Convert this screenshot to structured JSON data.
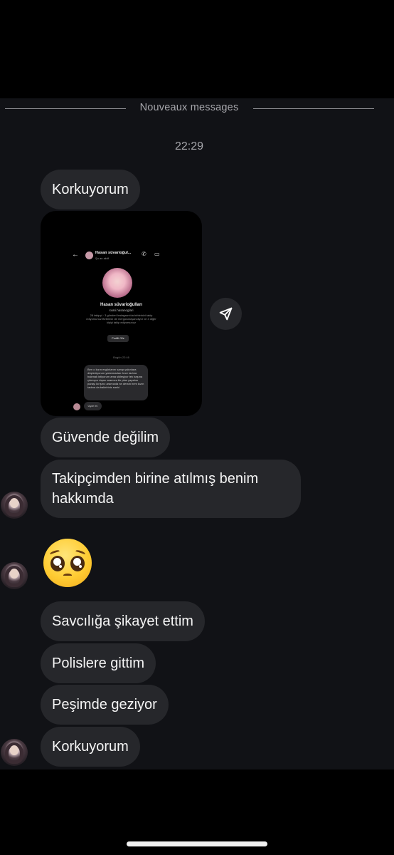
{
  "divider": {
    "label": "Nouveaux messages"
  },
  "timestamp": "22:29",
  "messages": [
    {
      "text": "Korkuyorum"
    },
    {
      "text": "Güvende değilim"
    },
    {
      "text": "Takipçimden birine atılmış benim hakkımda"
    },
    {
      "text": "🥺"
    },
    {
      "text": "Savcılığa şikayet ettim"
    },
    {
      "text": "Polislere gittim"
    },
    {
      "text": "Peşimde geziyor"
    },
    {
      "text": "Korkuyorum"
    }
  ],
  "screenshot": {
    "header_name": "Hasan süvarioğul...",
    "header_sub": "Şu an aktif",
    "profile_name": "Hasan süvarioğulları",
    "profile_user": "svari.hasanoglari",
    "profile_info": "28 takipçi · 3 gönderi Instagram'da birbirinizi takip ediyorsunuz Birbiriniz de mergosdarşanoliyor ve 4 diğer kişiyi takip ediyorsunuz",
    "profile_button": "Profili Gör",
    "time": "Bugün 22:46",
    "message": "Ben o kızın ergünlarını sanıp yakınlara düşünüyorum yakınmadan önce tadına bakmak istiyorum ama sikleşiyor tek başına çıkmıyor dışarı aramıza bir plan yapalım paraşı kırışırız aramızda ne derstn hem kızın tadına da bakiririniz sanki",
    "reply": "Uyar mı"
  },
  "icons": {
    "share": "share-arrow-icon",
    "avatar": "contact-avatar-icon",
    "emoji": "pleading-face-emoji-icon"
  },
  "colors": {
    "background": "#111216",
    "bubble": "#26272b",
    "text": "#f5f5f5",
    "muted": "#a6a6ab"
  }
}
